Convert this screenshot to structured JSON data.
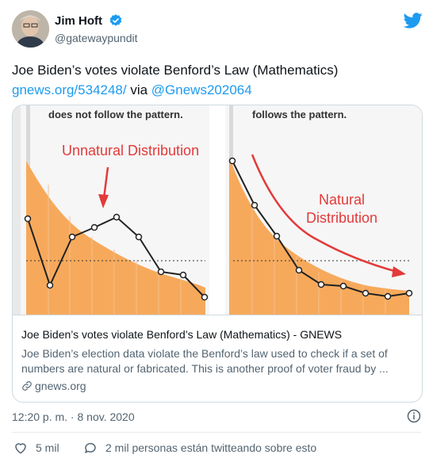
{
  "header": {
    "name": "Jim Hoft",
    "handle": "@gatewaypundit"
  },
  "tweet": {
    "text": "Joe Biden’s votes violate Benford’s Law (Mathematics)",
    "link": "gnews.org/534248/",
    "via": " via ",
    "mention": "@Gnews202064"
  },
  "card": {
    "left_panel_caption": "does not follow the pattern.",
    "left_annotation": "Unnatural Distribution",
    "right_panel_caption": "follows the pattern.",
    "right_annotation_line1": "Natural",
    "right_annotation_line2": "Distribution",
    "title": "Joe Biden’s votes violate Benford’s Law (Mathematics) - GNEWS",
    "description": "Joe Biden’s election data violate the Benford’s law used to check if a set of numbers are natural or fabricated. This is another proof of voter fraud by ...",
    "domain": "gnews.org"
  },
  "timestamp": "12:20 p. m. · 8 nov. 2020",
  "actions": {
    "likes": "5 mil",
    "talking": "2 mil personas están twitteando sobre esto"
  },
  "colors": {
    "accent": "#1d9bf0",
    "orange": "#f7a95b",
    "red": "#e33a3a"
  }
}
